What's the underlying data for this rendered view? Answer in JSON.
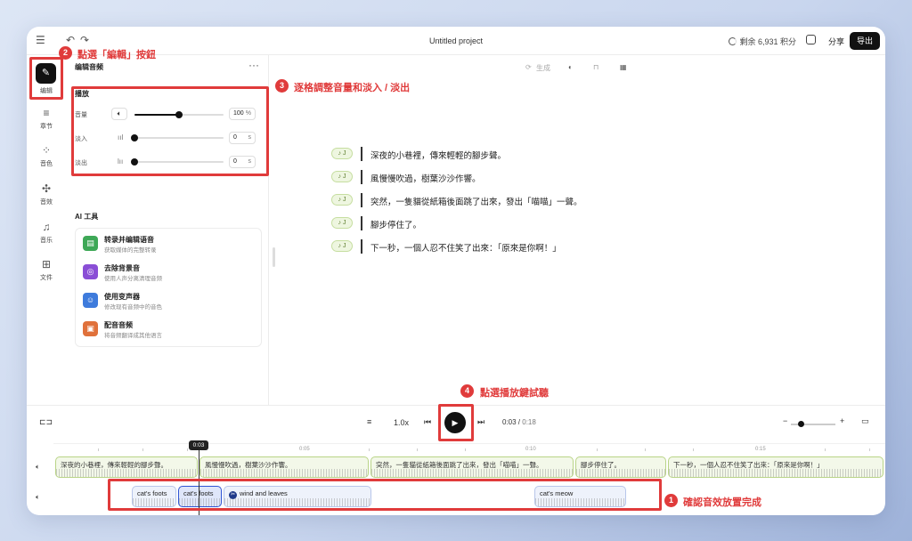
{
  "app": {
    "title": "Untitled project",
    "credits": "剩余 6,931 积分",
    "share_label": "分享",
    "export_label": "导出"
  },
  "rail": [
    {
      "label": "编辑",
      "icon": "edit-icon"
    },
    {
      "label": "章节",
      "icon": "chapters-icon"
    },
    {
      "label": "音色",
      "icon": "voices-icon"
    },
    {
      "label": "音效",
      "icon": "sound-effects-icon"
    },
    {
      "label": "音乐",
      "icon": "music-icon"
    },
    {
      "label": "文件",
      "icon": "files-icon"
    }
  ],
  "panel": {
    "title": "编辑音频",
    "playback": {
      "heading": "播放",
      "volume": {
        "label": "音量",
        "value": "100",
        "unit": "%",
        "level": 0.5
      },
      "fade_in": {
        "label": "淡入",
        "value": "0",
        "unit": "s",
        "level": 0
      },
      "fade_out": {
        "label": "淡出",
        "value": "0",
        "unit": "s",
        "level": 0
      }
    },
    "ai_heading": "AI 工具",
    "ai_tools": [
      {
        "name": "转录并编辑语音",
        "desc": "获取媒体的完整转录",
        "color": "#3ea857"
      },
      {
        "name": "去除背景音",
        "desc": "使用人声分离清理音频",
        "color": "#8a4ed6"
      },
      {
        "name": "使用变声器",
        "desc": "修改现有音频中的音色",
        "color": "#3e7bdc"
      },
      {
        "name": "配音音频",
        "desc": "将音频翻译成其他语言",
        "color": "#e0713b"
      }
    ]
  },
  "editor": {
    "generate_label": "生成",
    "lines": [
      "深夜的小巷裡，傳來輕輕的腳步聲。",
      "風慢慢吹過，樹葉沙沙作響。",
      "突然，一隻貓從紙箱後面跳了出來，發出「喵喵」一聲。",
      "腳步停住了。",
      "下一秒，一個人忍不住笑了出來：「原來是你啊！」"
    ],
    "line_tag": "♪ J"
  },
  "timeline": {
    "speed": "1.0x",
    "current_time": "0:03",
    "total_time": "0:18",
    "playhead_label": "0:03",
    "ruler_ticks": [
      "0:05",
      "0:10",
      "0:15"
    ],
    "voice_clips": [
      "深夜的小巷裡，傳來輕輕的腳步聲。",
      "風慢慢吹過，樹葉沙沙作響。",
      "突然，一隻貓從紙箱後面跳了出來，發出「喵喵」一聲。",
      "腳步停住了。",
      "下一秒，一個人忍不住笑了出來：「原來是你啊！」"
    ],
    "sfx_clips": [
      "cat's foots",
      "cat's foots",
      "wind and leaves",
      "cat's meow"
    ]
  },
  "annotations": [
    {
      "num": "1",
      "text": "確認音效放置完成"
    },
    {
      "num": "2",
      "text": "點選「編輯」按鈕"
    },
    {
      "num": "3",
      "text": "逐格調整音量和淡入 / 淡出"
    },
    {
      "num": "4",
      "text": "點選播放鍵試聽"
    }
  ],
  "colors": {
    "accent": "#e03b3b",
    "voice_clip": "#b9d487",
    "sfx_clip": "#b8c6ea"
  }
}
